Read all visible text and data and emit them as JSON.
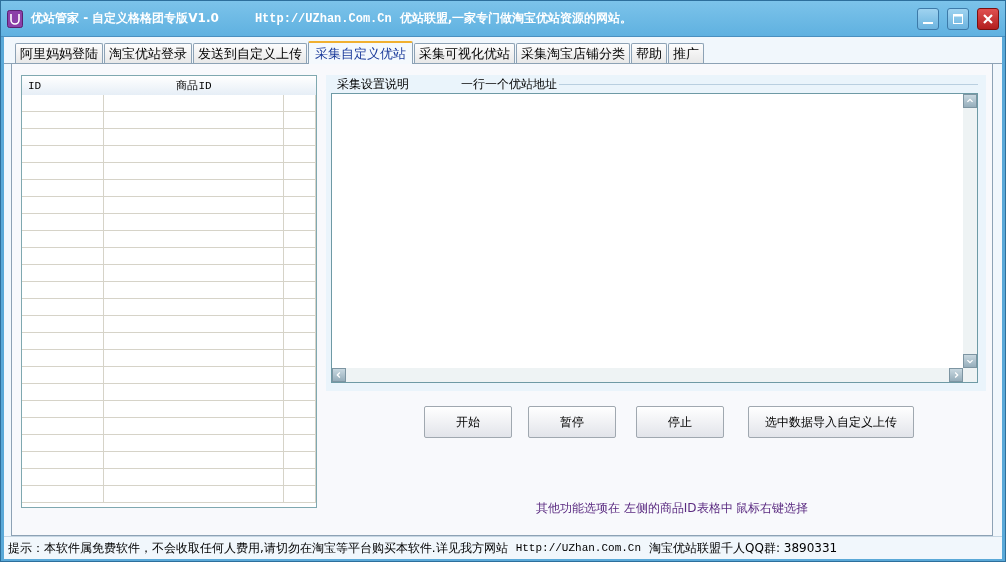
{
  "window": {
    "title": "优站管家 - 自定义格格团专版V1.0",
    "url": "Http://UZhan.Com.Cn",
    "slogan": "优站联盟,一家专门做淘宝优站资源的网站。"
  },
  "tabs": [
    {
      "label": "阿里妈妈登陆",
      "selected": false
    },
    {
      "label": "淘宝优站登录",
      "selected": false
    },
    {
      "label": "发送到自定义上传",
      "selected": false
    },
    {
      "label": "采集自定义优站",
      "selected": true
    },
    {
      "label": "采集可视化优站",
      "selected": false
    },
    {
      "label": "采集淘宝店铺分类",
      "selected": false
    },
    {
      "label": "帮助",
      "selected": false
    },
    {
      "label": "推广",
      "selected": false
    }
  ],
  "table": {
    "columns": [
      "ID",
      "商品ID"
    ]
  },
  "collect_panel": {
    "legend": "采集设置说明",
    "field_label": "一行一个优站地址"
  },
  "buttons": [
    "开始",
    "暂停",
    "停止",
    "选中数据导入自定义上传"
  ],
  "hint": "其他功能选项在 左侧的商品ID表格中 鼠标右键选择",
  "status_bar": {
    "notice": "提示：本软件属免费软件，不会收取任何人费用,请切勿在淘宝等平台购买本软件.详见我方网站",
    "url": "Http://UZhan.Com.Cn",
    "qq_group": "淘宝优站联盟千人QQ群: 3890331"
  }
}
